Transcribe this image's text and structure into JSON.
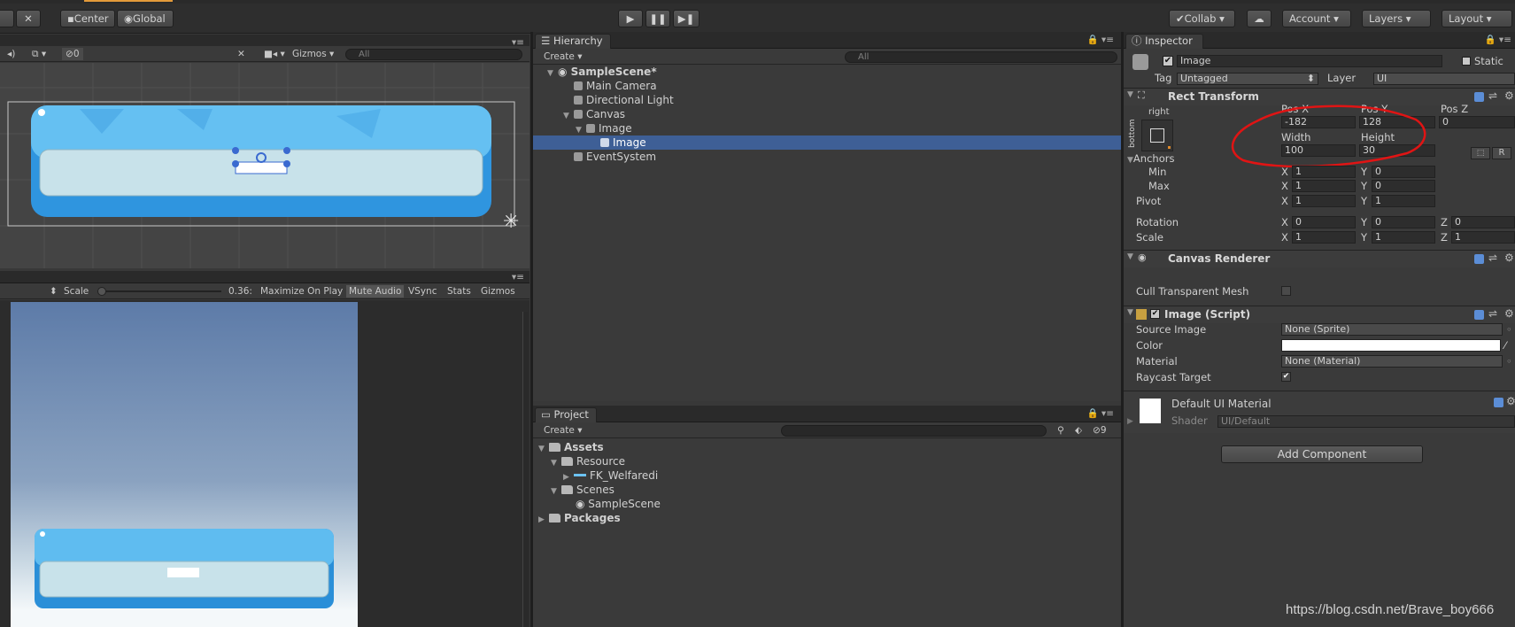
{
  "toolbar": {
    "center_label": "Center",
    "global_label": "Global",
    "collab_label": "Collab",
    "account_label": "Account",
    "layers_label": "Layers",
    "layout_label": "Layout"
  },
  "scene": {
    "gizmos_label": "Gizmos",
    "search_placeholder": "All",
    "hidden_count": "0"
  },
  "game": {
    "scale_label": "Scale",
    "scale_value": "0.36:",
    "buttons": [
      "Maximize On Play",
      "Mute Audio",
      "VSync",
      "Stats",
      "Gizmos"
    ]
  },
  "hierarchy": {
    "tab": "Hierarchy",
    "create_label": "Create",
    "search_placeholder": "All",
    "scene_name": "SampleScene*",
    "items": [
      "Main Camera",
      "Directional Light",
      "Canvas",
      "Image",
      "Image",
      "EventSystem"
    ]
  },
  "project": {
    "tab": "Project",
    "create_label": "Create",
    "hidden_count": "9",
    "items": [
      "Assets",
      "Resource",
      "FK_Welfaredi",
      "Scenes",
      "SampleScene",
      "Packages"
    ]
  },
  "inspector": {
    "tab": "Inspector",
    "object_name": "Image",
    "static_label": "Static",
    "tag_label": "Tag",
    "tag_value": "Untagged",
    "layer_label": "Layer",
    "layer_value": "UI",
    "rect_transform": {
      "title": "Rect Transform",
      "anchor_h": "right",
      "anchor_v": "bottom",
      "posx_label": "Pos X",
      "posy_label": "Pos Y",
      "posz_label": "Pos Z",
      "posx_value": "-182",
      "posy_value": "128",
      "posz_value": "0",
      "width_label": "Width",
      "height_label": "Height",
      "width_value": "100",
      "height_value": "30",
      "r_label": "R",
      "anchors_label": "Anchors",
      "min_label": "Min",
      "max_label": "Max",
      "min_x": "1",
      "min_y": "0",
      "max_x": "1",
      "max_y": "0",
      "pivot_label": "Pivot",
      "pivot_x": "1",
      "pivot_y": "1",
      "rotation_label": "Rotation",
      "rot_x": "0",
      "rot_y": "0",
      "rot_z": "0",
      "scale_label": "Scale",
      "scale_x": "1",
      "scale_y": "1",
      "scale_z": "1"
    },
    "canvas_renderer": {
      "title": "Canvas Renderer",
      "cull_label": "Cull Transparent Mesh"
    },
    "image_script": {
      "title": "Image (Script)",
      "source_label": "Source Image",
      "source_value": "None (Sprite)",
      "color_label": "Color",
      "material_label": "Material",
      "material_value": "None (Material)",
      "raycast_label": "Raycast Target"
    },
    "material": {
      "name": "Default UI Material",
      "shader_label": "Shader",
      "shader_value": "UI/Default"
    },
    "add_component": "Add Component"
  },
  "watermark": "https://blog.csdn.net/Brave_boy666",
  "colors": {
    "selection": "#3e5f96",
    "button_blue": "#3aa8e8",
    "annotation_red": "#e01414"
  }
}
